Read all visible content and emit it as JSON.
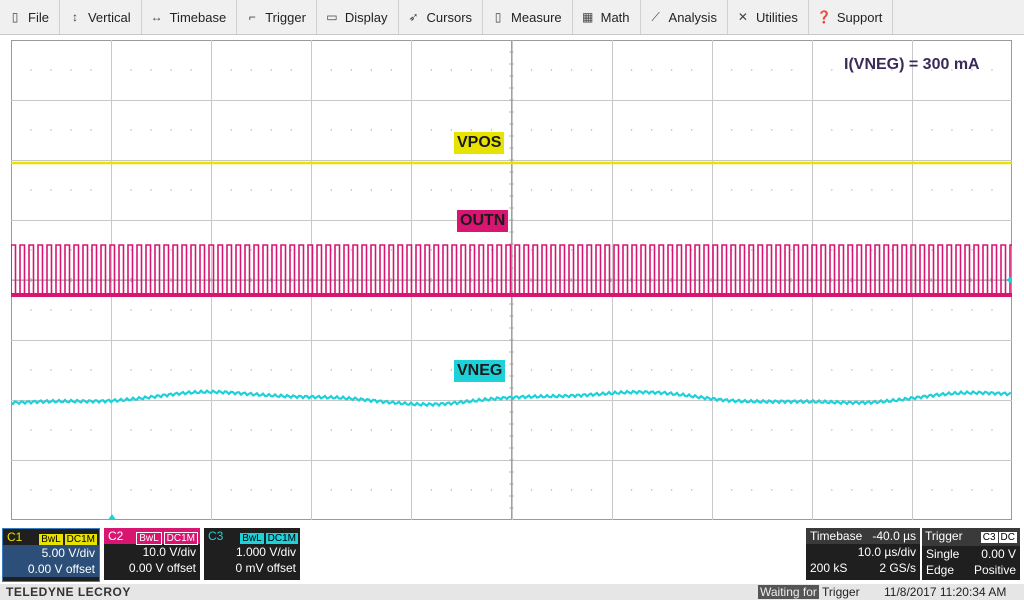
{
  "menu": {
    "items": [
      {
        "label": "File",
        "icon": "file-icon"
      },
      {
        "label": "Vertical",
        "icon": "vertical-arrows-icon"
      },
      {
        "label": "Timebase",
        "icon": "horizontal-arrows-icon"
      },
      {
        "label": "Trigger",
        "icon": "trigger-icon"
      },
      {
        "label": "Display",
        "icon": "display-icon"
      },
      {
        "label": "Cursors",
        "icon": "cursor-icon"
      },
      {
        "label": "Measure",
        "icon": "measure-icon"
      },
      {
        "label": "Math",
        "icon": "calculator-icon"
      },
      {
        "label": "Analysis",
        "icon": "analysis-icon"
      },
      {
        "label": "Utilities",
        "icon": "utilities-icon"
      },
      {
        "label": "Support",
        "icon": "support-icon"
      }
    ]
  },
  "screen": {
    "annotation": "I(VNEG) = 300 mA",
    "traces": [
      {
        "name": "VPOS",
        "color": "#e8e200"
      },
      {
        "name": "OUTN",
        "color": "#d81672"
      },
      {
        "name": "VNEG",
        "color": "#1ed0d8"
      }
    ]
  },
  "channels": [
    {
      "tag": "C1",
      "bwl": "BwL",
      "coupling": "DC1M",
      "scale": "5.00 V/div",
      "offset": "0.00 V offset",
      "color": "#e8e200"
    },
    {
      "tag": "C2",
      "bwl": "BwL",
      "coupling": "DC1M",
      "scale": "10.0 V/div",
      "offset": "0.00 V offset",
      "color": "#d81672"
    },
    {
      "tag": "C3",
      "bwl": "BwL",
      "coupling": "DC1M",
      "scale": "1.000 V/div",
      "offset": "0 mV offset",
      "color": "#1ed0d8"
    }
  ],
  "timebase": {
    "title": "Timebase",
    "delay": "-40.0 µs",
    "scale": "10.0 µs/div",
    "samples": "200 kS",
    "rate": "2 GS/s"
  },
  "trigger": {
    "title": "Trigger",
    "source": "C3",
    "coupling": "DC",
    "mode": "Single",
    "level": "0.00 V",
    "type": "Edge",
    "slope": "Positive"
  },
  "status": {
    "brand": "TELEDYNE LECROY",
    "waiting_a": "Waiting for",
    "waiting_b": " Trigger",
    "datetime": "11/8/2017 11:20:34 AM"
  }
}
